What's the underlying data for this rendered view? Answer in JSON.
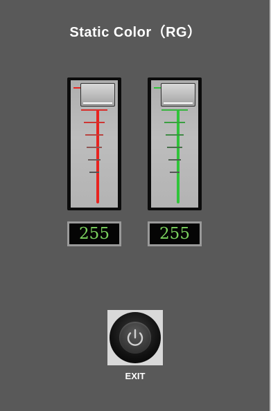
{
  "title": "Static Color（RG）",
  "sliders": [
    {
      "id": "red",
      "value": "255",
      "color": "#e8231f",
      "level": 1.0
    },
    {
      "id": "green",
      "value": "255",
      "color": "#30c43a",
      "level": 1.0
    }
  ],
  "exit": {
    "label": "EXIT",
    "icon": "power-icon"
  },
  "colors": {
    "background": "#595959",
    "lcd_text": "#7cd35f"
  }
}
